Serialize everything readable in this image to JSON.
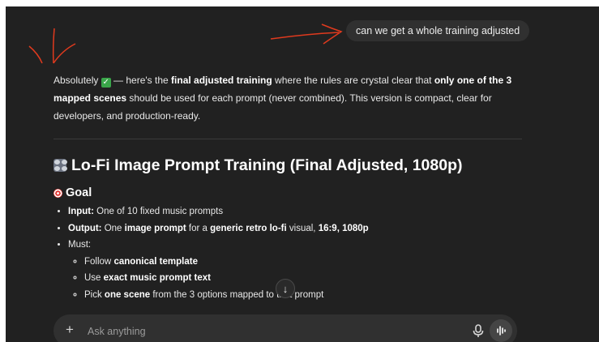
{
  "conversation": {
    "user_message": "can we get a whole training adjusted",
    "assistant": {
      "intro": {
        "p1": "Absolutely ",
        "check_icon": "check-mark-button",
        "p2": " — here's the ",
        "b1": "final adjusted training",
        "p3": " where the rules are crystal clear that ",
        "b2": "only one of the 3 mapped scenes",
        "p4": " should be used for each prompt (never combined). This version is compact, clear for developers, and production-ready."
      },
      "heading_icon": "control-knobs-icon",
      "heading": "Lo-Fi Image Prompt Training (Final Adjusted, 1080p)",
      "goal_icon": "direct-hit-icon",
      "goal_heading": "Goal",
      "bullets": [
        {
          "label": "Input:",
          "text": " One of 10 fixed music prompts"
        },
        {
          "label": "Output:",
          "t1": " One ",
          "b1": "image prompt",
          "t2": " for a ",
          "b2": "generic retro lo-fi",
          "t3": " visual, ",
          "b3": "16:9, 1080p"
        },
        {
          "text": "Must:"
        }
      ],
      "sub_bullets": [
        {
          "t1": "Follow ",
          "b1": "canonical template"
        },
        {
          "t1": "Use ",
          "b1": "exact music prompt text"
        },
        {
          "t1": "Pick ",
          "b1": "one scene",
          "t2": " from the 3 options mapped to that prompt"
        }
      ]
    }
  },
  "scroll_button": {
    "icon": "arrow-down-icon",
    "glyph": "↓"
  },
  "composer": {
    "placeholder": "Ask anything",
    "plus_icon": "plus-icon",
    "plus_glyph": "+",
    "mic_icon": "microphone-icon",
    "voice_icon": "voice-mode-icon"
  },
  "colors": {
    "background": "#212121",
    "bubble": "#303030",
    "text": "#e8e8e8",
    "annotation": "#e03a1e"
  }
}
